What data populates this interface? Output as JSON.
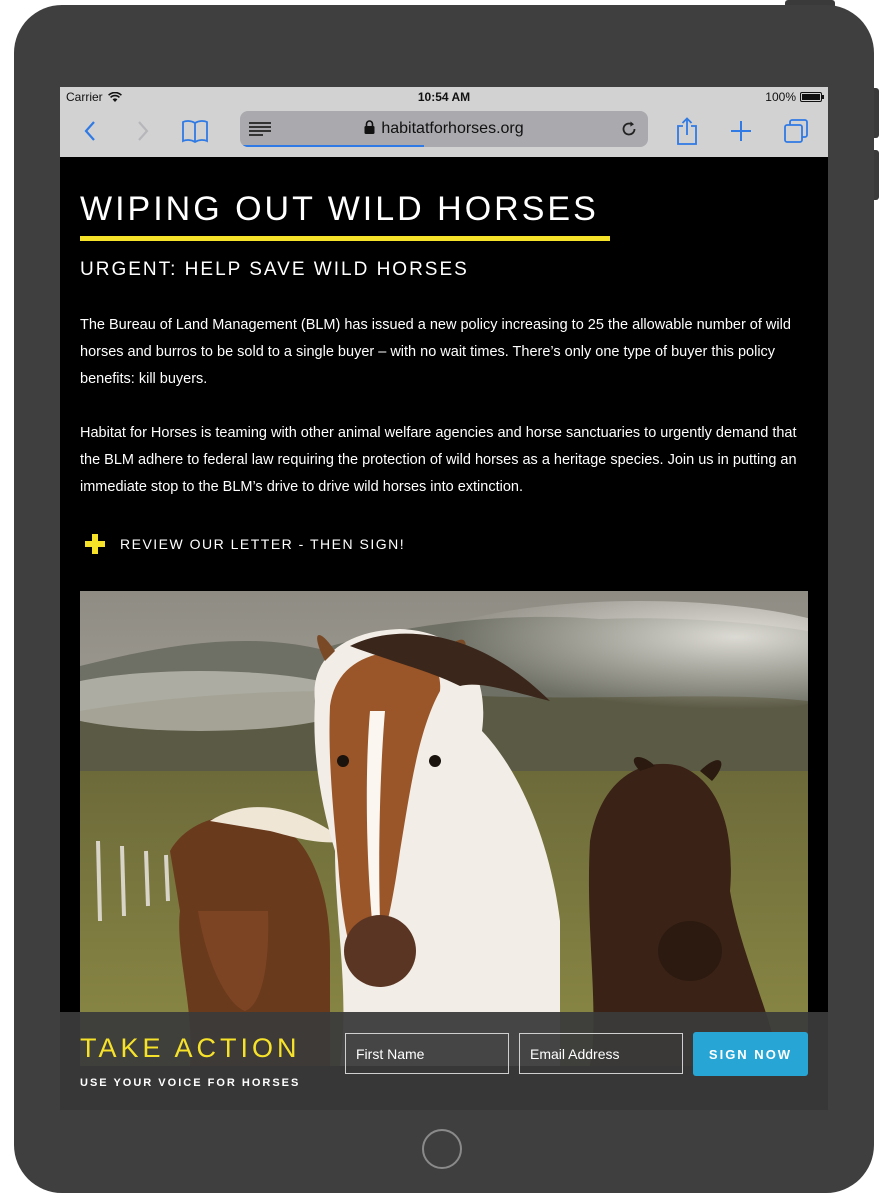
{
  "status_bar": {
    "carrier": "Carrier",
    "time": "10:54 AM",
    "battery": "100%"
  },
  "browser": {
    "url": "habitatforhorses.org",
    "load_progress": 0.45,
    "accent_color": "#2f7ae5",
    "icons": [
      "back-icon",
      "forward-icon",
      "bookmarks-icon",
      "reader-icon",
      "lock-icon",
      "reload-icon",
      "share-icon",
      "new-tab-icon",
      "tabs-icon"
    ]
  },
  "page": {
    "title": "WIPING OUT WILD HORSES",
    "subtitle": "URGENT: HELP SAVE WILD HORSES",
    "paragraphs": [
      "The Bureau of Land Management (BLM) has issued a new policy increasing to 25 the allowable number of wild horses and burros to be sold to a single buyer – with no wait times. There’s only one type of buyer this policy benefits: kill buyers.",
      "Habitat for Horses is teaming with other animal welfare agencies and horse sanctuaries to urgently demand that the BLM adhere to federal law requiring the protection of wild horses as a heritage species. Join us in putting an immediate stop to the BLM’s drive to drive wild horses into extinction."
    ],
    "review_link": "REVIEW OUR LETTER - THEN SIGN!",
    "accent_color": "#f7e22a"
  },
  "action_bar": {
    "title": "TAKE ACTION",
    "subtitle": "USE YOUR VOICE FOR HORSES",
    "first_name_placeholder": "First Name",
    "email_placeholder": "Email Address",
    "button_label": "SIGN NOW",
    "button_color": "#27a6d6"
  }
}
